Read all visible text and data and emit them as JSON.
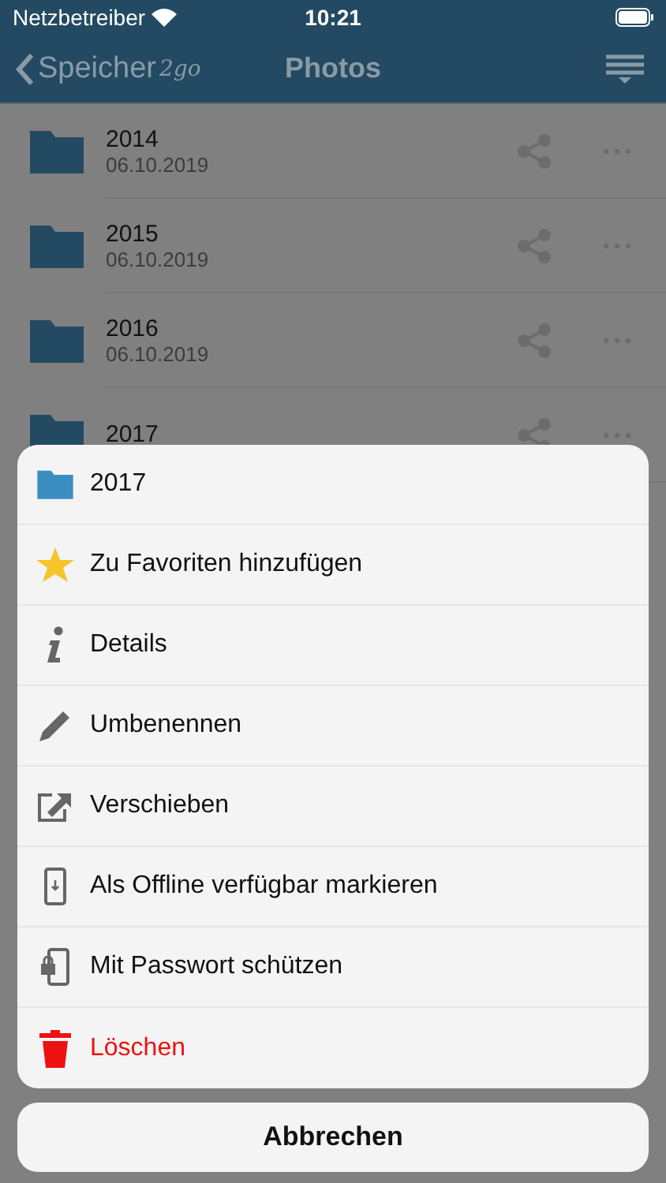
{
  "status_bar": {
    "carrier": "Netzbetreiber",
    "time": "10:21"
  },
  "nav_bar": {
    "back_logo": "Speicher",
    "back_logo_script": "2go",
    "title": "Photos"
  },
  "folders": [
    {
      "name": "2014",
      "date": "06.10.2019"
    },
    {
      "name": "2015",
      "date": "06.10.2019"
    },
    {
      "name": "2016",
      "date": "06.10.2019"
    },
    {
      "name": "2017"
    }
  ],
  "action_sheet": {
    "title": "2017",
    "items": [
      {
        "kind": "star",
        "label": "Zu Favoriten hinzufügen",
        "destructive": false
      },
      {
        "kind": "info",
        "label": "Details",
        "destructive": false
      },
      {
        "kind": "pencil",
        "label": "Umbenennen",
        "destructive": false
      },
      {
        "kind": "move",
        "label": "Verschieben",
        "destructive": false
      },
      {
        "kind": "offline",
        "label": "Als Offline verfügbar markieren",
        "destructive": false
      },
      {
        "kind": "password",
        "label": "Mit Passwort schützen",
        "destructive": false
      },
      {
        "kind": "trash",
        "label": "Löschen",
        "destructive": true
      }
    ],
    "cancel": "Abbrechen"
  }
}
